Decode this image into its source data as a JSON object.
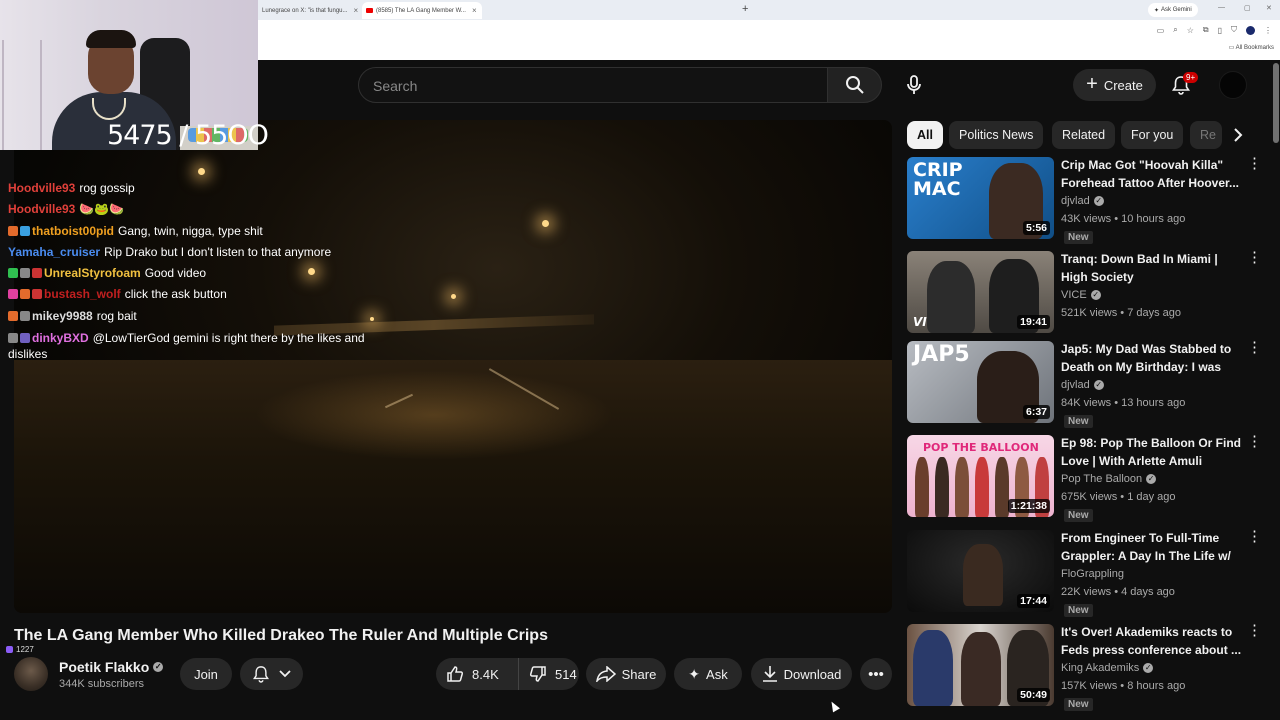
{
  "browser": {
    "tabs": [
      {
        "label": "Lunegrace on X: \"is that fungu...",
        "close": "×"
      },
      {
        "label": "(8585) The LA Gang Member W...",
        "close": "×"
      }
    ],
    "new_tab": "+",
    "ask_gemini": "Ask Gemini",
    "bookmarks": "All Bookmarks"
  },
  "header": {
    "search_placeholder": "Search",
    "create_label": "Create",
    "notif_badge": "9+"
  },
  "stream_overlay": {
    "counter": "5475 / 55OO",
    "viewer_count": "1227",
    "chat": [
      {
        "user": "Hoodville93",
        "user_color": "#e0403a",
        "msg": "rog gossip",
        "badges": []
      },
      {
        "user": "Hoodville93",
        "user_color": "#e0403a",
        "msg": "🍉🐸🍉",
        "badges": []
      },
      {
        "user": "thatboist00pid",
        "user_color": "#f0a020",
        "msg": "Gang, twin, nigga, type shit",
        "badges": [
          "#e36b2c",
          "#3aa0e0"
        ]
      },
      {
        "user": "Yamaha_cruiser",
        "user_color": "#4a8cf0",
        "msg": "Rip Drako but I don't listen to that anymore",
        "badges": []
      },
      {
        "user": "UnrealStyrofoam",
        "user_color": "#f0c040",
        "msg": "Good video",
        "badges": [
          "#30c050",
          "#888888",
          "#cc3333"
        ]
      },
      {
        "user": "bustash_wolf",
        "user_color": "#c02020",
        "msg": "click the ask button",
        "badges": [
          "#e040a0",
          "#e36b2c",
          "#cc3333"
        ]
      },
      {
        "user": "mikey9988",
        "user_color": "#dddddd",
        "msg": "rog bait",
        "badges": [
          "#e36b2c",
          "#888888"
        ]
      },
      {
        "user": "dinkyBXD",
        "user_color": "#e070e0",
        "msg": "@LowTierGod gemini is right there by the likes and dislikes",
        "badges": [
          "#888888",
          "#7060c0"
        ]
      }
    ]
  },
  "video": {
    "title": "The LA Gang Member Who Killed Drakeo The Ruler And Multiple Crips",
    "channel": "Poetik Flakko",
    "subscribers": "344K subscribers",
    "join_label": "Join",
    "likes": "8.4K",
    "dislikes": "514",
    "share_label": "Share",
    "ask_label": "Ask",
    "download_label": "Download",
    "more_label": "•••"
  },
  "chips": [
    "All",
    "Politics News",
    "Related",
    "For you",
    "Re"
  ],
  "recommended": [
    {
      "title": "Crip Mac Got \"Hoovah Killa\" Forehead Tattoo After Hoover...",
      "channel": "djvlad",
      "verified": true,
      "meta": "43K views • 10 hours ago",
      "badge": "New",
      "duration": "5:56",
      "thumb_text": "CRIP MAC",
      "thumb_color": "#1f6fb2"
    },
    {
      "title": "Tranq: Down Bad In Miami | High Society",
      "channel": "VICE",
      "verified": true,
      "meta": "521K views • 7 days ago",
      "badge": "",
      "duration": "19:41",
      "thumb_text": "VICE",
      "thumb_color": "#6e6a63"
    },
    {
      "title": "Jap5: My Dad Was Stabbed to Death on My Birthday: I was in...",
      "channel": "djvlad",
      "verified": true,
      "meta": "84K views • 13 hours ago",
      "badge": "New",
      "duration": "6:37",
      "thumb_text": "JAP5",
      "thumb_color": "#9aa0a6"
    },
    {
      "title": "Ep 98: Pop The Balloon Or Find Love | With Arlette Amuli",
      "channel": "Pop The Balloon",
      "verified": true,
      "meta": "675K views • 1 day ago",
      "badge": "New",
      "duration": "1:21:38",
      "thumb_text": "POP THE BALLOON",
      "thumb_color": "#f2a6c8"
    },
    {
      "title": "From Engineer To Full-Time Grappler: A Day In The Life w/ ...",
      "channel": "FloGrappling",
      "verified": false,
      "meta": "22K views • 4 days ago",
      "badge": "New",
      "duration": "17:44",
      "thumb_text": "",
      "thumb_color": "#1a1a1a"
    },
    {
      "title": "It's Over! Akademiks reacts to Feds press conference about ...",
      "channel": "King Akademiks",
      "verified": true,
      "meta": "157K views • 8 hours ago",
      "badge": "New",
      "duration": "50:49",
      "thumb_text": "",
      "thumb_color": "#5a4a3e"
    }
  ]
}
